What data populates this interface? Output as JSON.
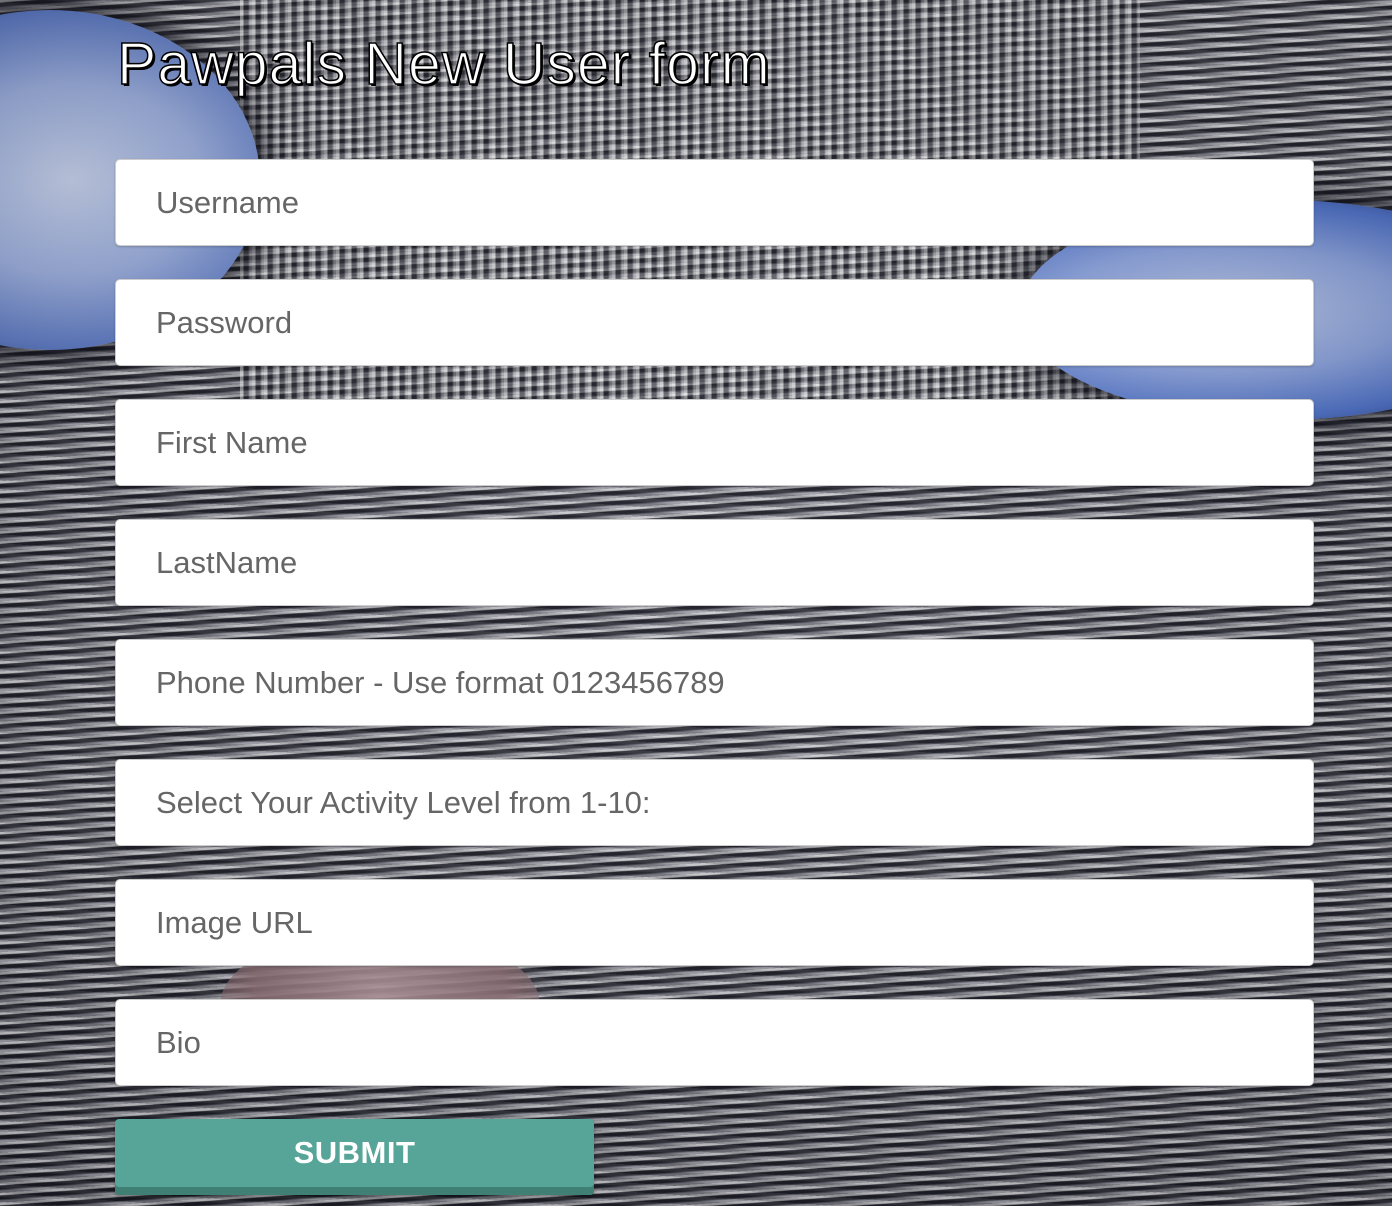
{
  "page": {
    "title": "Pawpals New User form"
  },
  "form": {
    "fields": {
      "username": {
        "placeholder": "Username",
        "value": ""
      },
      "password": {
        "placeholder": "Password",
        "value": ""
      },
      "first_name": {
        "placeholder": "First Name",
        "value": ""
      },
      "last_name": {
        "placeholder": "LastName",
        "value": ""
      },
      "phone": {
        "placeholder": "Phone Number - Use format 0123456789",
        "value": ""
      },
      "activity_level": {
        "placeholder": "Select Your Activity Level from 1-10:",
        "value": ""
      },
      "image_url": {
        "placeholder": "Image URL",
        "value": ""
      },
      "bio": {
        "placeholder": "Bio",
        "value": ""
      }
    },
    "submit_label": "SUBMIT"
  },
  "colors": {
    "submit_background": "#56a598",
    "field_background": "#ffffff",
    "placeholder_text": "#666666",
    "title_text": "#ffffff"
  }
}
